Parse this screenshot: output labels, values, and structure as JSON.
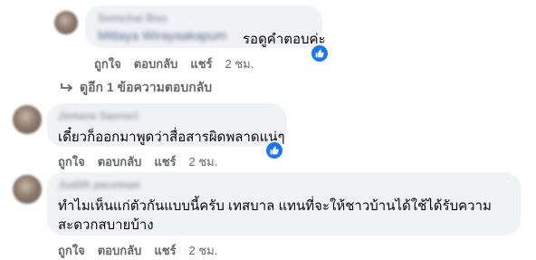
{
  "comments": [
    {
      "author": "Somchai Boo",
      "mention": "Mittaya Wirayaakapum",
      "text": "รอดูคำตอบค่ะ",
      "reaction_icon": "like-icon",
      "actions": {
        "like": "ถูกใจ",
        "reply": "ตอบกลับ",
        "share": "แชร์",
        "time": "2 ชม."
      }
    },
    {
      "author": "Jintana Saensri",
      "text": "เดี๋ยวก็ออกมาพูดว่าสื่อสารผิดพลาดแน่ๆ",
      "reaction_icon": "like-icon",
      "actions": {
        "like": "ถูกใจ",
        "reply": "ตอบกลับ",
        "share": "แชร์",
        "time": "2 ชม."
      }
    },
    {
      "author": "Judith paceman",
      "text_line1": "ทำไมเห็นแก่ตัวกันแบบนี้ครับ เทสบาล แทนที่จะให้ชาวบ้านได้ใช้ได้รับความ",
      "text_line2": "สะดวกสบายบ้าง",
      "actions": {
        "like": "ถูกใจ",
        "reply": "ตอบกลับ",
        "share": "แชร์",
        "time": "2 ชม."
      }
    }
  ],
  "replies_link": {
    "label": "ดูอีก 1 ข้อความตอบกลับ",
    "icon": "reply-arrow-icon"
  },
  "colors": {
    "bubble": "#f0f2f5",
    "like": "#1877f2",
    "meta": "#65676b"
  }
}
